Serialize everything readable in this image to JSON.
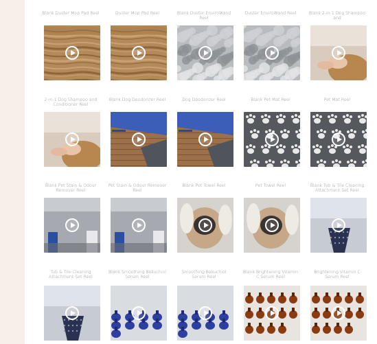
{
  "reels": [
    {
      "label": "Blank Duster Mop Pad Reel",
      "scene": "wood"
    },
    {
      "label": "Duster Mop Pad Reel",
      "scene": "wood"
    },
    {
      "label": "Blank Duster EnviroWand Reel",
      "scene": "fluffy"
    },
    {
      "label": "Duster EnviroWand Reel",
      "scene": "fluffy"
    },
    {
      "label": "Blank 2-in-1 Dog Shampoo and",
      "scene": "dogwash"
    },
    {
      "label": "2-in-1 Dog Shampoo and Conditioner Reel",
      "scene": "dogwash"
    },
    {
      "label": "Blank Dog Deodorizer Reel",
      "scene": "floor"
    },
    {
      "label": "Dog Deodorizer Reel",
      "scene": "floor"
    },
    {
      "label": "Blank Pet Mat Reel",
      "scene": "mat"
    },
    {
      "label": "Pet Mat Reel",
      "scene": "mat"
    },
    {
      "label": "Blank Pet Stain & Odour Remover Reel",
      "scene": "stain"
    },
    {
      "label": "Pet Stain & Odour Remover Reel",
      "scene": "stain"
    },
    {
      "label": "Blank Pet Towel Reel",
      "scene": "pug"
    },
    {
      "label": "Pet Towel Reel",
      "scene": "pug"
    },
    {
      "label": "Blank Tub & Tile Cleaning Attachment Set Reel",
      "scene": "tub"
    },
    {
      "label": "Tub & Tile Cleaning Attachment Set Reel",
      "scene": "tub"
    },
    {
      "label": "Blank Smoothing Bakuchiol Serum Reel",
      "scene": "serum"
    },
    {
      "label": "Smoothing Bakuchiol Serum Reel",
      "scene": "serum"
    },
    {
      "label": "Blank Brightening Vitamin C Serum Reel",
      "scene": "vitc"
    },
    {
      "label": "Brightening Vitamin C Serum Reel",
      "scene": "vitc"
    }
  ],
  "icons": {
    "play": "play-circle-icon"
  },
  "colors": {
    "background": "#f7efea",
    "card": "#ffffff",
    "label": "#8a8a8a"
  }
}
